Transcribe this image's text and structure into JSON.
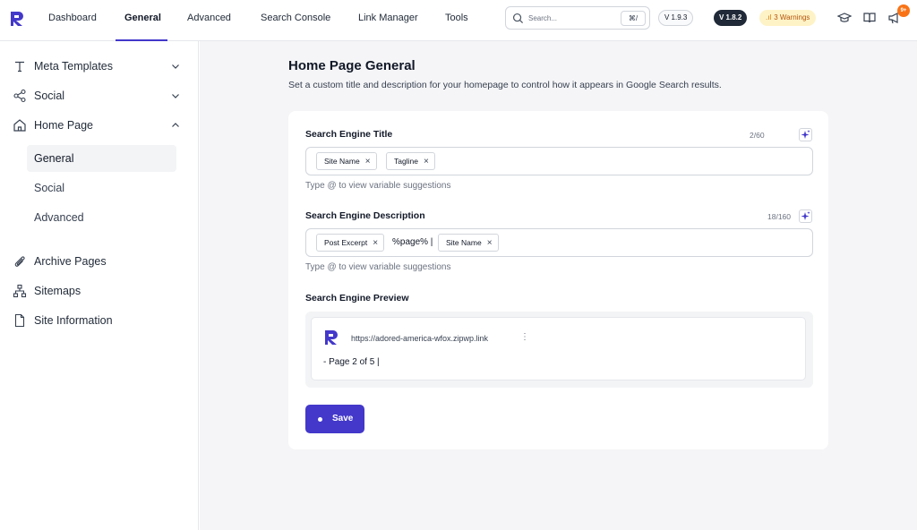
{
  "nav": {
    "items": [
      "Dashboard",
      "General",
      "Advanced",
      "Search Console",
      "Link Manager",
      "Tools"
    ],
    "active": "General"
  },
  "search": {
    "placeholder": "Search...",
    "shortcut": "⌘/"
  },
  "badges": {
    "version_free": "V 1.9.3",
    "version_pro": "V 1.8.2",
    "warnings": "3 Warnings",
    "notifications": "9+"
  },
  "sidebar": {
    "items": [
      {
        "label": "Meta Templates",
        "icon": "type-icon",
        "chevron": "down"
      },
      {
        "label": "Social",
        "icon": "share-icon",
        "chevron": "down"
      },
      {
        "label": "Home Page",
        "icon": "home-icon",
        "chevron": "up"
      }
    ],
    "sub_items": [
      "General",
      "Social",
      "Advanced"
    ],
    "active_sub": "General",
    "bottom_items": [
      {
        "label": "Archive Pages",
        "icon": "paperclip-icon"
      },
      {
        "label": "Sitemaps",
        "icon": "sitemap-icon"
      },
      {
        "label": "Site Information",
        "icon": "file-icon"
      }
    ]
  },
  "page": {
    "title": "Home Page General",
    "subtitle": "Set a custom title and description for your homepage to control how it appears in Google Search results."
  },
  "form": {
    "title_label": "Search Engine Title",
    "title_counter": "2/60",
    "title_tags": [
      "Site Name",
      "Tagline"
    ],
    "title_hint": "Type @ to view variable suggestions",
    "desc_label": "Search Engine Description",
    "desc_counter": "18/160",
    "desc_tag_1": "Post Excerpt",
    "desc_text": "%page% |",
    "desc_tag_2": "Site Name",
    "desc_hint": "Type @ to view variable suggestions",
    "preview_label": "Search Engine Preview",
    "preview_url": "https://adored-america-wfox.zipwp.link",
    "preview_title": "- Page 2 of 5 |",
    "save_label": "Save"
  },
  "colors": {
    "accent": "#4338ca",
    "warning_bg": "#fef3c7",
    "warning_text": "#b45309",
    "notif": "#f97316"
  }
}
